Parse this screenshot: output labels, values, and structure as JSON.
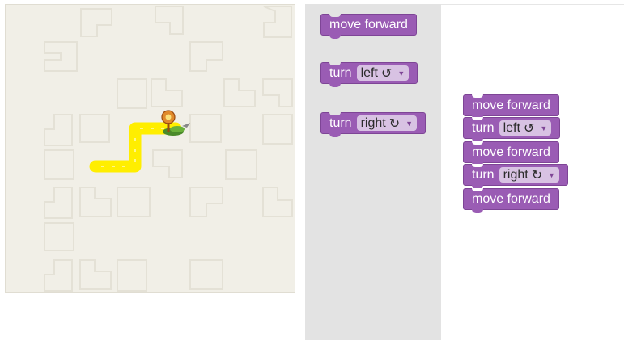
{
  "toolbox": {
    "blocks": [
      {
        "label": "move forward"
      },
      {
        "label": "turn",
        "dropdown": "left",
        "glyph": "↺"
      },
      {
        "label": "turn",
        "dropdown": "right",
        "glyph": "↻"
      }
    ]
  },
  "workspace": {
    "stack": [
      {
        "label": "move forward"
      },
      {
        "label": "turn",
        "dropdown": "left",
        "glyph": "↺"
      },
      {
        "label": "move forward"
      },
      {
        "label": "turn",
        "dropdown": "right",
        "glyph": "↻"
      },
      {
        "label": "move forward"
      }
    ]
  },
  "colors": {
    "block": "#9a5cb4",
    "dropdown": "#d8c2e3",
    "path": "#ffee00",
    "maze_bg": "#f1efe7",
    "toolbox_bg": "#e3e3e3"
  },
  "icons": {
    "goal": "pin-marker-icon",
    "player": "green-pegman-icon"
  }
}
